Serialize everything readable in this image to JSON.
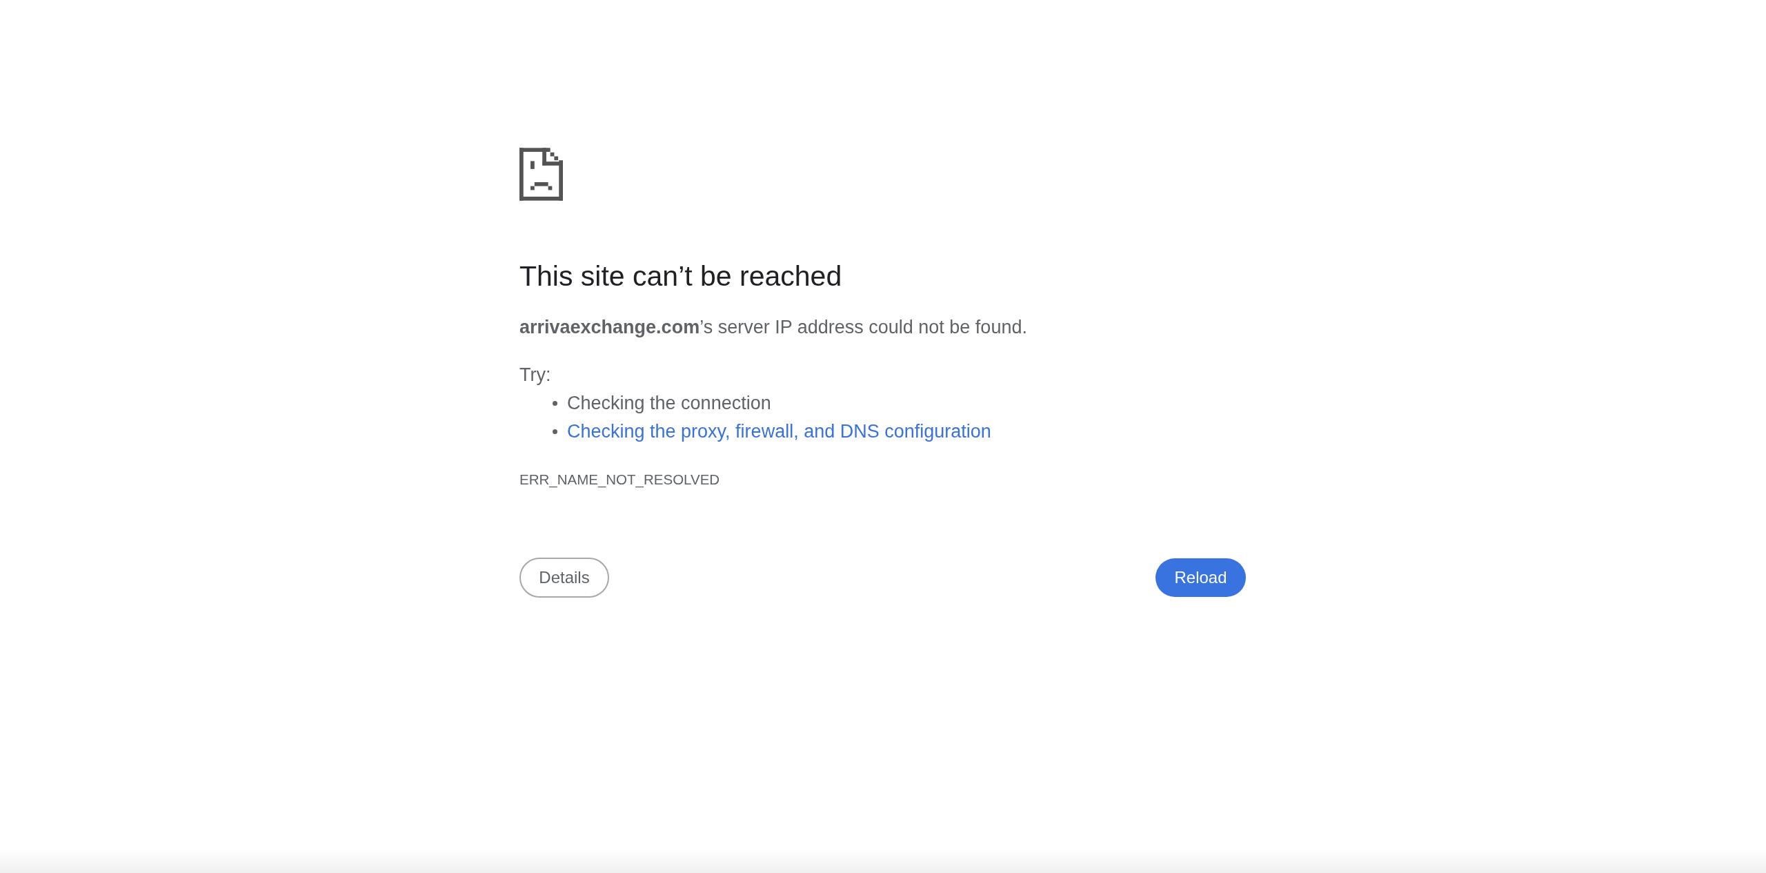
{
  "page": {
    "title": "This site can’t be reached",
    "message": "**arrivaexchange.com**’s server IP address could not be found.",
    "suggestions_heading": "Try:",
    "suggestions": [
      {
        "text": "Checking the connection",
        "kind": "text"
      },
      {
        "text": "Checking the proxy, firewall, and DNS configuration",
        "kind": "link"
      }
    ],
    "error_code": "ERR_NAME_NOT_RESOLVED"
  },
  "buttons": [
    {
      "label": "Details",
      "kind": "secondary"
    },
    {
      "label": "Reload",
      "kind": "primary"
    }
  ]
}
